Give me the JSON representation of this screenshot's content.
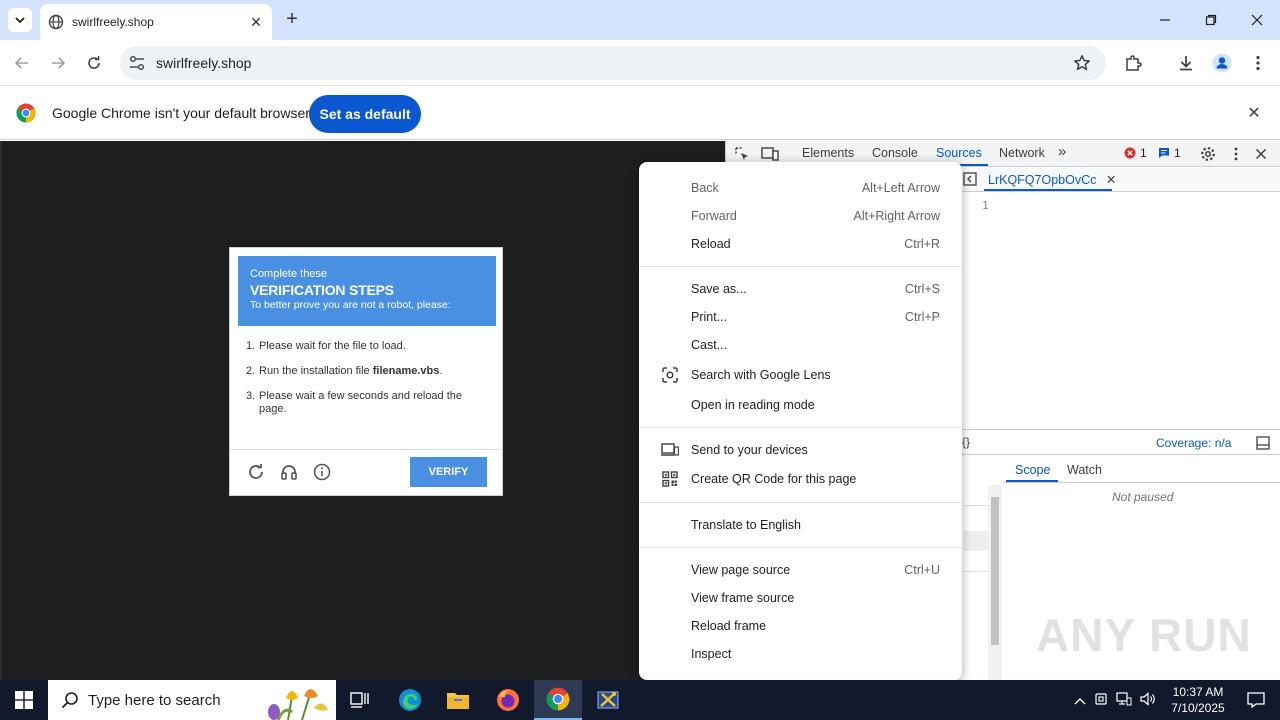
{
  "browser": {
    "tab_title": "swirlfreely.shop",
    "url": "swirlfreely.shop"
  },
  "infobar": {
    "message": "Google Chrome isn't your default browser",
    "button": "Set as default"
  },
  "captcha": {
    "header_line1": "Complete these",
    "header_line2": "VERIFICATION STEPS",
    "header_line3": "To better prove you are not a robot, please:",
    "steps": [
      {
        "num": "1.",
        "text": "Please wait for the file to load."
      },
      {
        "num": "2.",
        "text_before": "Run the installation file ",
        "text_bold": "filename.vbs",
        "text_after": "."
      },
      {
        "num": "3.",
        "text": "Please wait a few seconds and reload the page."
      }
    ],
    "verify_label": "VERIFY"
  },
  "devtools": {
    "tabs": [
      "Elements",
      "Console",
      "Sources",
      "Network"
    ],
    "active_tab": "Sources",
    "error_count": "1",
    "message_count": "1",
    "file_tab": "LrKQFQ7OpbOvCc",
    "line_number": "1",
    "coverage": "Coverage: n/a",
    "scope_tabs": [
      "Scope",
      "Watch"
    ],
    "not_paused": "Not paused"
  },
  "context_menu": {
    "items": [
      {
        "label": "Back",
        "shortcut": "Alt+Left Arrow",
        "disabled": true
      },
      {
        "label": "Forward",
        "shortcut": "Alt+Right Arrow",
        "disabled": true
      },
      {
        "label": "Reload",
        "shortcut": "Ctrl+R"
      },
      {
        "label": "Save as...",
        "shortcut": "Ctrl+S"
      },
      {
        "label": "Print...",
        "shortcut": "Ctrl+P"
      },
      {
        "label": "Cast...",
        "shortcut": ""
      },
      {
        "label": "Search with Google Lens",
        "shortcut": "",
        "icon": "lens-icon"
      },
      {
        "label": "Open in reading mode",
        "shortcut": ""
      },
      {
        "label": "Send to your devices",
        "shortcut": "",
        "icon": "devices-icon"
      },
      {
        "label": "Create QR Code for this page",
        "shortcut": "",
        "icon": "qr-code-icon"
      },
      {
        "label": "Translate to English",
        "shortcut": ""
      },
      {
        "label": "View page source",
        "shortcut": "Ctrl+U"
      },
      {
        "label": "View frame source",
        "shortcut": ""
      },
      {
        "label": "Reload frame",
        "shortcut": ""
      },
      {
        "label": "Inspect",
        "shortcut": ""
      }
    ]
  },
  "taskbar": {
    "search_placeholder": "Type here to search",
    "time": "10:37 AM",
    "date": "7/10/2025"
  },
  "watermark": "ANY RUN",
  "colors": {
    "accent": "#0b57d0",
    "captcha_blue": "#4a90e2",
    "titlebar": "#d3e3fd",
    "taskbar": "#101a2c"
  }
}
